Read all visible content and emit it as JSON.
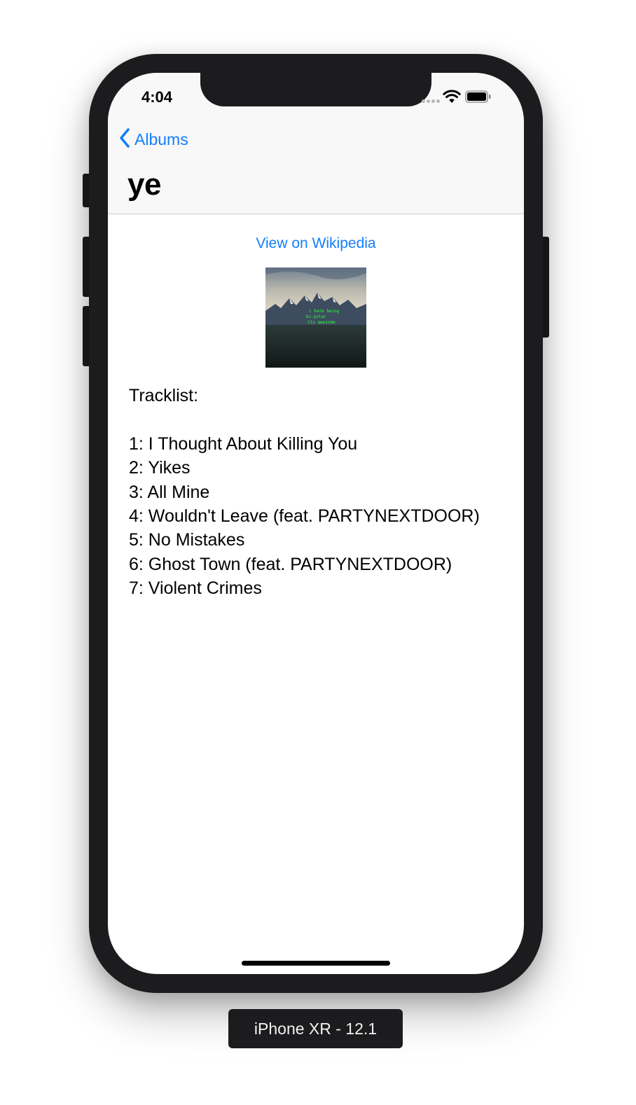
{
  "status_bar": {
    "time": "4:04",
    "icons": [
      "cellular-dots-icon",
      "wifi-icon",
      "battery-icon"
    ]
  },
  "navigation": {
    "back_label": "Albums",
    "back_icon": "chevron-left-icon",
    "title": "ye"
  },
  "content": {
    "wikipedia_link": "View on Wikipedia",
    "album_cover": "album-art",
    "tracklist_label": "Tracklist:",
    "tracks": [
      "1: I Thought About Killing You",
      "2: Yikes",
      "3: All Mine",
      "4: Wouldn't Leave (feat. PARTYNEXTDOOR)",
      "5: No Mistakes",
      "6: Ghost Town (feat. PARTYNEXTDOOR)",
      "7: Violent Crimes"
    ]
  },
  "device_label": "iPhone XR - 12.1",
  "colors": {
    "accent": "#147efb",
    "frame": "#1c1c1e",
    "navbar_background": "#f8f8f8"
  }
}
